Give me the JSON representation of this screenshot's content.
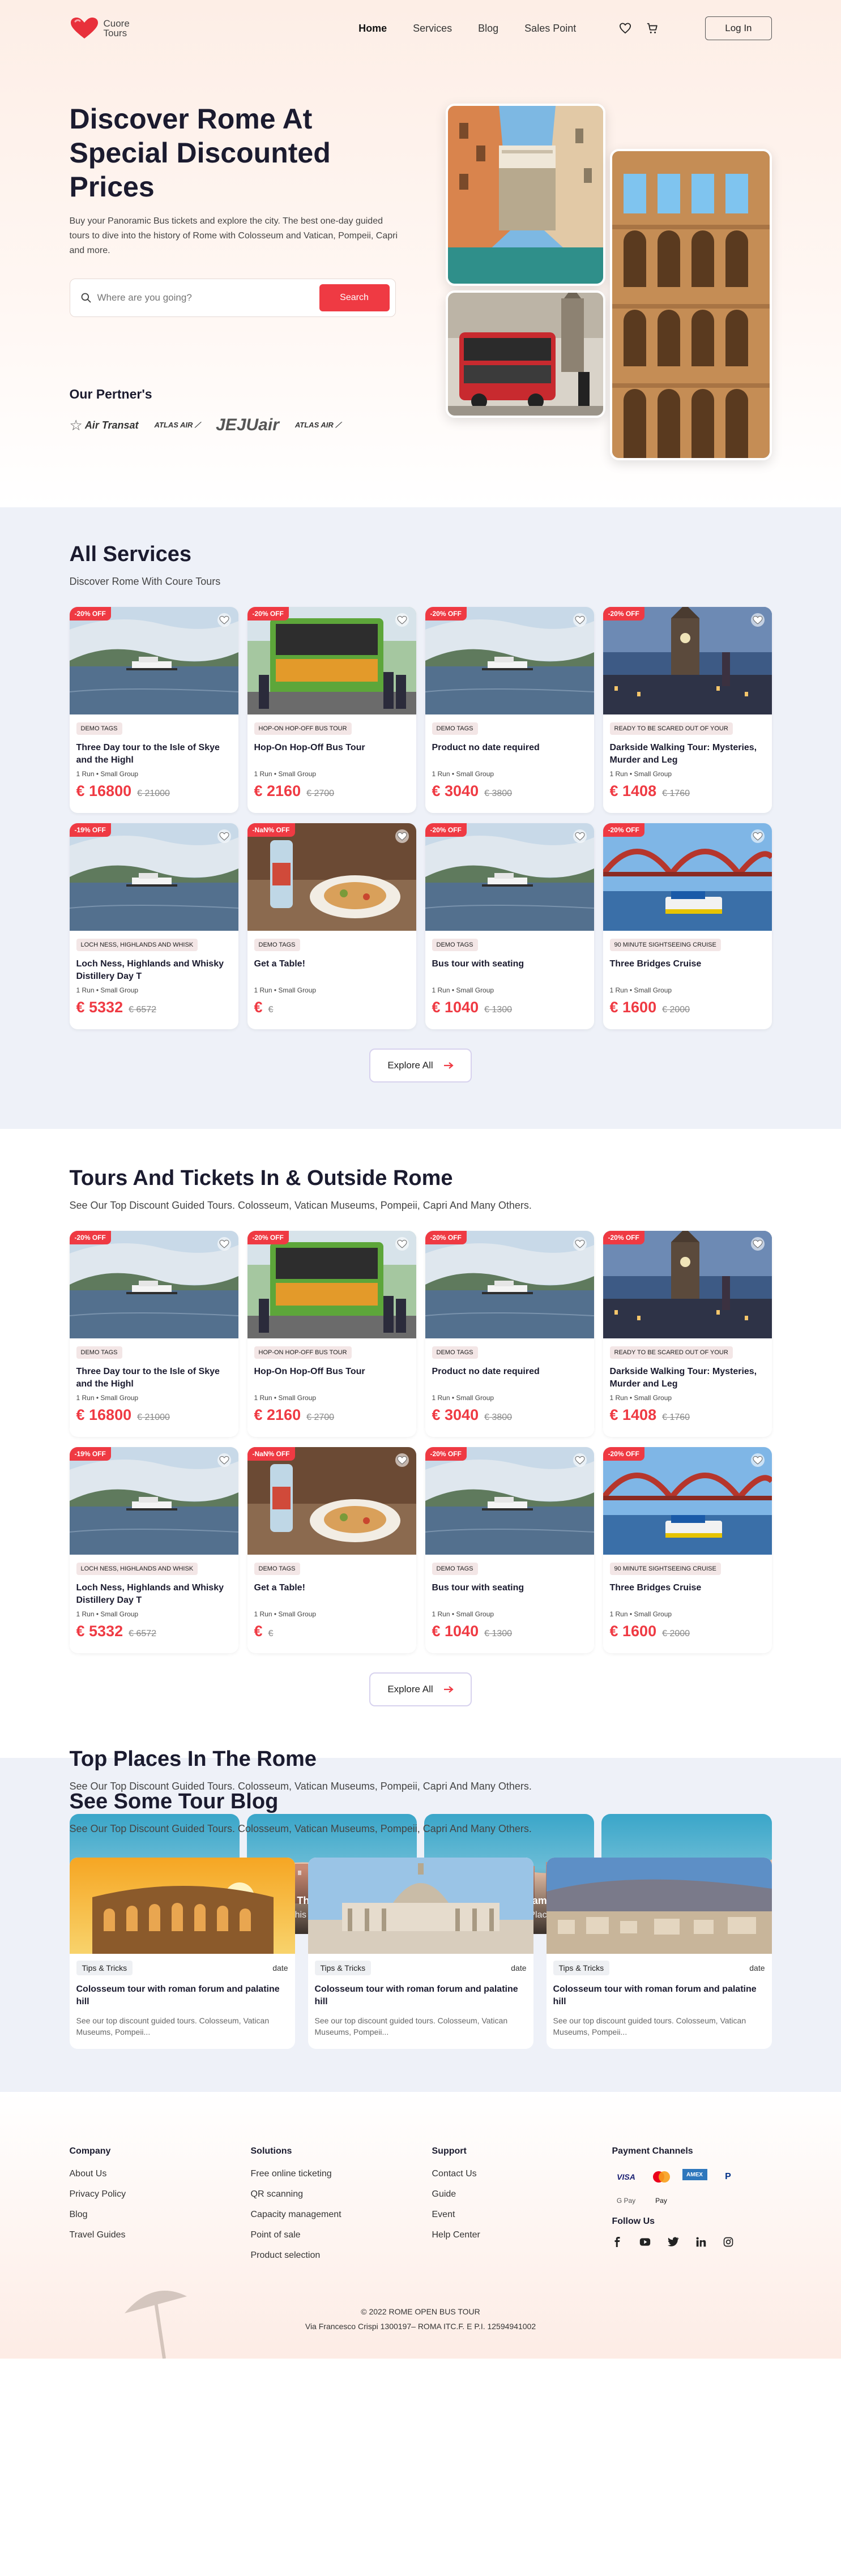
{
  "header": {
    "logo_line1": "Cuore",
    "logo_line2": "Tours",
    "nav": [
      "Home",
      "Services",
      "Blog",
      "Sales Point"
    ],
    "login": "Log In"
  },
  "hero": {
    "title": "Discover Rome At Special Discounted Prices",
    "description": "Buy your Panoramic Bus tickets and explore the city. The best one-day guided tours to dive into the history of Rome with Colosseum and Vatican, Pompeii, Capri and more.",
    "search_placeholder": "Where are you going?",
    "search_button": "Search",
    "partners_title": "Our Pertner's",
    "partners": [
      "Air Transat",
      "ATLAS AIR",
      "JEJUair",
      "ATLAS AIR"
    ]
  },
  "services": {
    "title": "All Services",
    "subtitle": "Discover Rome With Coure Tours",
    "explore": "Explore All"
  },
  "tours": {
    "title": "Tours And Tickets In & Outside Rome",
    "subtitle": "See Our Top Discount Guided Tours. Colosseum, Vatican Museums, Pompeii, Capri And Many Others.",
    "explore": "Explore All"
  },
  "cards": [
    {
      "discount": "-20% OFF",
      "tag": "DEMO TAGS",
      "title": "Three Day tour to the Isle of Skye and the Highl",
      "meta": "1 Run  •  Small Group",
      "price": "€ 16800",
      "old": "€ 21000",
      "img": "lake"
    },
    {
      "discount": "-20% OFF",
      "tag": "HOP-ON HOP-OFF BUS TOUR",
      "title": "Hop-On Hop-Off Bus Tour",
      "meta": "1 Run  •  Small Group",
      "price": "€ 2160",
      "old": "€ 2700",
      "img": "bus"
    },
    {
      "discount": "-20% OFF",
      "tag": "DEMO TAGS",
      "title": "Product no date required",
      "meta": "1 Run  •  Small Group",
      "price": "€ 3040",
      "old": "€ 3800",
      "img": "lake"
    },
    {
      "discount": "-20% OFF",
      "tag": "READY TO BE SCARED OUT OF YOUR",
      "title": "Darkside Walking Tour: Mysteries, Murder and Leg",
      "meta": "1 Run  •  Small Group",
      "price": "€ 1408",
      "old": "€ 1760",
      "img": "tower"
    },
    {
      "discount": "-19% OFF",
      "tag": "LOCH NESS, HIGHLANDS AND WHISK",
      "title": "Loch Ness, Highlands and Whisky Distillery Day T",
      "meta": "1 Run  •  Small Group",
      "price": "€ 5332",
      "old": "€ 6572",
      "img": "lake"
    },
    {
      "discount": "-NaN% OFF",
      "tag": "DEMO TAGS",
      "title": "Get a Table!",
      "meta": "1 Run  •  Small Group",
      "price": "€",
      "old": "€",
      "img": "food"
    },
    {
      "discount": "-20% OFF",
      "tag": "DEMO TAGS",
      "title": "Bus tour with seating",
      "meta": "1 Run  •  Small Group",
      "price": "€ 1040",
      "old": "€ 1300",
      "img": "lake"
    },
    {
      "discount": "-20% OFF",
      "tag": "90 MINUTE SIGHTSEEING CRUISE",
      "title": "Three Bridges Cruise",
      "meta": "1 Run  •  Small Group",
      "price": "€ 1600",
      "old": "€ 2000",
      "img": "bridge"
    }
  ],
  "places": {
    "title": "Top Places In The Rome",
    "subtitle": "See Our Top Discount Guided Tours. Colosseum, Vatican Museums, Pompeii, Capri And Many Others.",
    "items": [
      {
        "title": "Title Of The Place Name",
        "subtitle": "Subtile This Beauty Of Place"
      },
      {
        "title": "Title Of The Place Name",
        "subtitle": "Subtile This Beauty Of Place"
      },
      {
        "title": "Title Of The Place Name",
        "subtitle": "Subtile This Beauty Of Place"
      },
      {
        "title": "Title Of The Place Name",
        "subtitle": "Subtile This Beauty Of Place"
      }
    ]
  },
  "blog": {
    "title": "See Some Tour Blog",
    "subtitle": "See Our Top Discount Guided Tours. Colosseum, Vatican Museums, Pompeii, Capri And Many Others.",
    "items": [
      {
        "tag": "Tips & Tricks",
        "date": "date",
        "title": "Colosseum tour with roman forum and palatine hill",
        "desc": "See our top discount guided tours. Colosseum, Vatican Museums, Pompeii...",
        "img": "colosseum"
      },
      {
        "tag": "Tips & Tricks",
        "date": "date",
        "title": "Colosseum tour with roman forum and palatine hill",
        "desc": "See our top discount guided tours. Colosseum, Vatican Museums, Pompeii...",
        "img": "vatican"
      },
      {
        "tag": "Tips & Tricks",
        "date": "date",
        "title": "Colosseum tour with roman forum and palatine hill",
        "desc": "See our top discount guided tours. Colosseum, Vatican Museums, Pompeii...",
        "img": "coast"
      }
    ]
  },
  "footer": {
    "company": {
      "title": "Company",
      "links": [
        "About Us",
        "Privacy Policy",
        "Blog",
        "Travel Guides"
      ]
    },
    "solutions": {
      "title": "Solutions",
      "links": [
        "Free online ticketing",
        "QR scanning",
        "Capacity management",
        "Point of sale",
        "Product selection"
      ]
    },
    "support": {
      "title": "Support",
      "links": [
        "Contact Us",
        "Guide",
        "Event",
        "Help Center"
      ]
    },
    "payment_title": "Payment Channels",
    "payments": [
      "VISA",
      "MC",
      "AMEX",
      "PayPal",
      "G Pay",
      "Apple Pay"
    ],
    "follow_title": "Follow Us",
    "social": [
      "facebook-icon",
      "youtube-icon",
      "twitter-icon",
      "linkedin-icon",
      "instagram-icon"
    ],
    "copyright": "© 2022 ROME OPEN BUS TOUR",
    "address": "Via Francesco Crispi 1300197– ROMA ITC.F. E P.I. 12594941002"
  },
  "colors": {
    "accent": "#ef3a43",
    "dark": "#1b1b2f",
    "gray_section": "#eef1f8"
  }
}
